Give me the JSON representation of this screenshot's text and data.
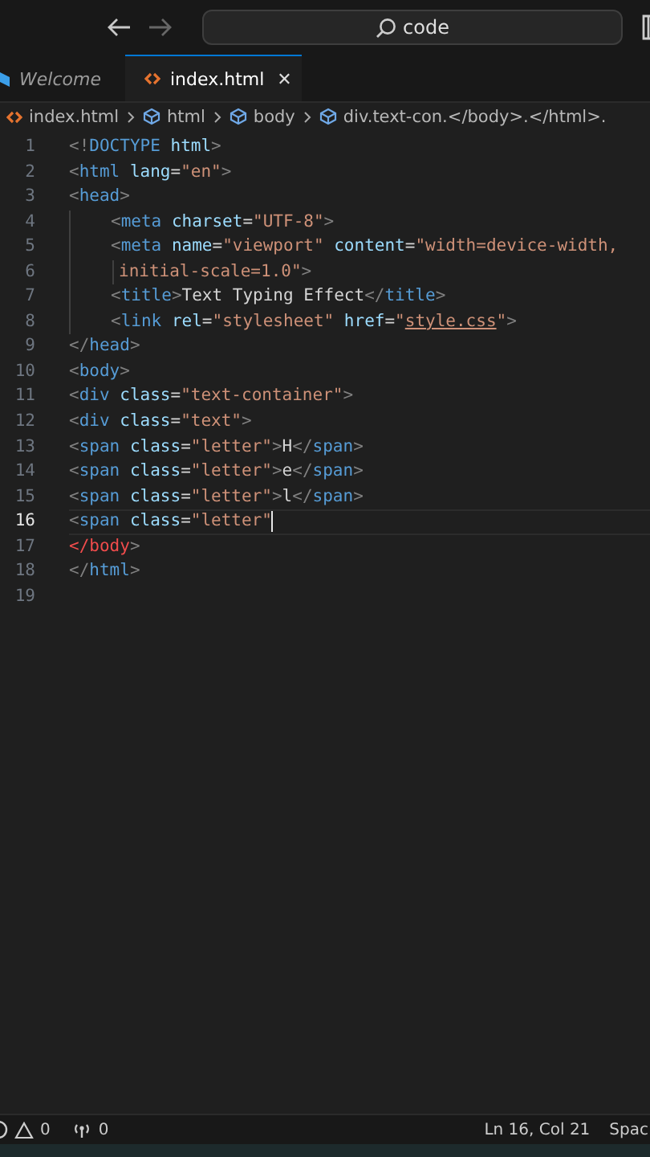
{
  "title_bar": {
    "search": {
      "value": "code"
    },
    "back_enabled": true,
    "forward_enabled": false
  },
  "tabs": [
    {
      "label": "Welcome",
      "kind": "welcome",
      "selected": false
    },
    {
      "label": "index.html",
      "kind": "html",
      "selected": true,
      "close": "✕"
    }
  ],
  "breadcrumb": [
    {
      "label": "index.html",
      "kind": "file"
    },
    {
      "label": "html",
      "kind": "element"
    },
    {
      "label": "body",
      "kind": "element"
    },
    {
      "label": "div.text-con.</body>.</html>.",
      "kind": "element"
    }
  ],
  "lines": [
    {
      "number": "1",
      "indented": false,
      "continuation": false,
      "current": false,
      "tokens": [
        {
          "kind": "punct",
          "text": "<!"
        },
        {
          "kind": "tag",
          "text": "DOCTYPE"
        },
        {
          "kind": "attr",
          "text": " html"
        },
        {
          "kind": "punct",
          "text": ">"
        }
      ]
    },
    {
      "number": "2",
      "indented": false,
      "continuation": false,
      "current": false,
      "tokens": [
        {
          "kind": "punct",
          "text": "<"
        },
        {
          "kind": "tag",
          "text": "html"
        },
        {
          "kind": "attr",
          "text": " lang"
        },
        {
          "kind": "text",
          "text": "="
        },
        {
          "kind": "str",
          "text": "\"en\""
        },
        {
          "kind": "punct",
          "text": ">"
        }
      ]
    },
    {
      "number": "3",
      "indented": false,
      "continuation": false,
      "current": false,
      "tokens": [
        {
          "kind": "punct",
          "text": "<"
        },
        {
          "kind": "tag",
          "text": "head"
        },
        {
          "kind": "punct",
          "text": ">"
        }
      ]
    },
    {
      "number": "4",
      "indented": true,
      "continuation": false,
      "current": false,
      "tokens": [
        {
          "kind": "punct",
          "text": "<"
        },
        {
          "kind": "tag",
          "text": "meta"
        },
        {
          "kind": "attr",
          "text": " charset"
        },
        {
          "kind": "text",
          "text": "="
        },
        {
          "kind": "str",
          "text": "\"UTF-8\""
        },
        {
          "kind": "punct",
          "text": ">"
        }
      ]
    },
    {
      "number": "5",
      "indented": true,
      "continuation": false,
      "current": false,
      "tokens": [
        {
          "kind": "punct",
          "text": "<"
        },
        {
          "kind": "tag",
          "text": "meta"
        },
        {
          "kind": "attr",
          "text": " name"
        },
        {
          "kind": "text",
          "text": "="
        },
        {
          "kind": "str",
          "text": "\"viewport\""
        },
        {
          "kind": "attr",
          "text": " content"
        },
        {
          "kind": "text",
          "text": "="
        },
        {
          "kind": "str",
          "text": "\"width=device-width,"
        }
      ]
    },
    {
      "number": "6",
      "indented": true,
      "continuation": true,
      "current": false,
      "tokens": [
        {
          "kind": "str",
          "text": "initial-scale=1.0\""
        },
        {
          "kind": "punct",
          "text": ">"
        }
      ]
    },
    {
      "number": "7",
      "indented": true,
      "continuation": false,
      "current": false,
      "tokens": [
        {
          "kind": "punct",
          "text": "<"
        },
        {
          "kind": "tag",
          "text": "title"
        },
        {
          "kind": "punct",
          "text": ">"
        },
        {
          "kind": "text",
          "text": "Text Typing Effect"
        },
        {
          "kind": "punct",
          "text": "</"
        },
        {
          "kind": "tag",
          "text": "title"
        },
        {
          "kind": "punct",
          "text": ">"
        }
      ]
    },
    {
      "number": "8",
      "indented": true,
      "continuation": false,
      "current": false,
      "tokens": [
        {
          "kind": "punct",
          "text": "<"
        },
        {
          "kind": "tag",
          "text": "link"
        },
        {
          "kind": "attr",
          "text": " rel"
        },
        {
          "kind": "text",
          "text": "="
        },
        {
          "kind": "str",
          "text": "\"stylesheet\""
        },
        {
          "kind": "attr",
          "text": " href"
        },
        {
          "kind": "text",
          "text": "="
        },
        {
          "kind": "str",
          "text": "\""
        },
        {
          "kind": "link",
          "text": "style.css"
        },
        {
          "kind": "str",
          "text": "\""
        },
        {
          "kind": "punct",
          "text": ">"
        }
      ]
    },
    {
      "number": "9",
      "indented": false,
      "continuation": false,
      "current": false,
      "tokens": [
        {
          "kind": "punct",
          "text": "</"
        },
        {
          "kind": "tag",
          "text": "head"
        },
        {
          "kind": "punct",
          "text": ">"
        }
      ]
    },
    {
      "number": "10",
      "indented": false,
      "continuation": false,
      "current": false,
      "tokens": [
        {
          "kind": "punct",
          "text": "<"
        },
        {
          "kind": "tag",
          "text": "body"
        },
        {
          "kind": "punct",
          "text": ">"
        }
      ]
    },
    {
      "number": "11",
      "indented": false,
      "continuation": false,
      "current": false,
      "tokens": [
        {
          "kind": "punct",
          "text": "<"
        },
        {
          "kind": "tag",
          "text": "div"
        },
        {
          "kind": "attr",
          "text": " class"
        },
        {
          "kind": "text",
          "text": "="
        },
        {
          "kind": "str",
          "text": "\"text-container\""
        },
        {
          "kind": "punct",
          "text": ">"
        }
      ]
    },
    {
      "number": "12",
      "indented": false,
      "continuation": false,
      "current": false,
      "tokens": [
        {
          "kind": "punct",
          "text": "<"
        },
        {
          "kind": "tag",
          "text": "div"
        },
        {
          "kind": "attr",
          "text": " class"
        },
        {
          "kind": "text",
          "text": "="
        },
        {
          "kind": "str",
          "text": "\"text\""
        },
        {
          "kind": "punct",
          "text": ">"
        }
      ]
    },
    {
      "number": "13",
      "indented": false,
      "continuation": false,
      "current": false,
      "tokens": [
        {
          "kind": "punct",
          "text": "<"
        },
        {
          "kind": "tag",
          "text": "span"
        },
        {
          "kind": "attr",
          "text": " class"
        },
        {
          "kind": "text",
          "text": "="
        },
        {
          "kind": "str",
          "text": "\"letter\""
        },
        {
          "kind": "punct",
          "text": ">"
        },
        {
          "kind": "text",
          "text": "H"
        },
        {
          "kind": "punct",
          "text": "</"
        },
        {
          "kind": "tag",
          "text": "span"
        },
        {
          "kind": "punct",
          "text": ">"
        }
      ]
    },
    {
      "number": "14",
      "indented": false,
      "continuation": false,
      "current": false,
      "tokens": [
        {
          "kind": "punct",
          "text": "<"
        },
        {
          "kind": "tag",
          "text": "span"
        },
        {
          "kind": "attr",
          "text": " class"
        },
        {
          "kind": "text",
          "text": "="
        },
        {
          "kind": "str",
          "text": "\"letter\""
        },
        {
          "kind": "punct",
          "text": ">"
        },
        {
          "kind": "text",
          "text": "e"
        },
        {
          "kind": "punct",
          "text": "</"
        },
        {
          "kind": "tag",
          "text": "span"
        },
        {
          "kind": "punct",
          "text": ">"
        }
      ]
    },
    {
      "number": "15",
      "indented": false,
      "continuation": false,
      "current": false,
      "tokens": [
        {
          "kind": "punct",
          "text": "<"
        },
        {
          "kind": "tag",
          "text": "span"
        },
        {
          "kind": "attr",
          "text": " class"
        },
        {
          "kind": "text",
          "text": "="
        },
        {
          "kind": "str",
          "text": "\"letter\""
        },
        {
          "kind": "punct",
          "text": ">"
        },
        {
          "kind": "text",
          "text": "l"
        },
        {
          "kind": "punct",
          "text": "</"
        },
        {
          "kind": "tag",
          "text": "span"
        },
        {
          "kind": "punct",
          "text": ">"
        }
      ]
    },
    {
      "number": "16",
      "indented": false,
      "continuation": false,
      "current": true,
      "tokens": [
        {
          "kind": "punct",
          "text": "<"
        },
        {
          "kind": "tag",
          "text": "span"
        },
        {
          "kind": "attr",
          "text": " class"
        },
        {
          "kind": "text",
          "text": "="
        },
        {
          "kind": "str",
          "text": "\"letter\""
        }
      ]
    },
    {
      "number": "17",
      "indented": false,
      "continuation": false,
      "current": false,
      "tokens": [
        {
          "kind": "err",
          "text": "</body"
        },
        {
          "kind": "punct",
          "text": ">"
        }
      ]
    },
    {
      "number": "18",
      "indented": false,
      "continuation": false,
      "current": false,
      "tokens": [
        {
          "kind": "punct",
          "text": "</"
        },
        {
          "kind": "tag",
          "text": "html"
        },
        {
          "kind": "punct",
          "text": ">"
        }
      ]
    },
    {
      "number": "19",
      "indented": false,
      "continuation": false,
      "current": false
    }
  ],
  "status_bar": {
    "warnings": "0",
    "ports": "0",
    "position": "Ln 16, Col 21",
    "indent": "Spac"
  }
}
